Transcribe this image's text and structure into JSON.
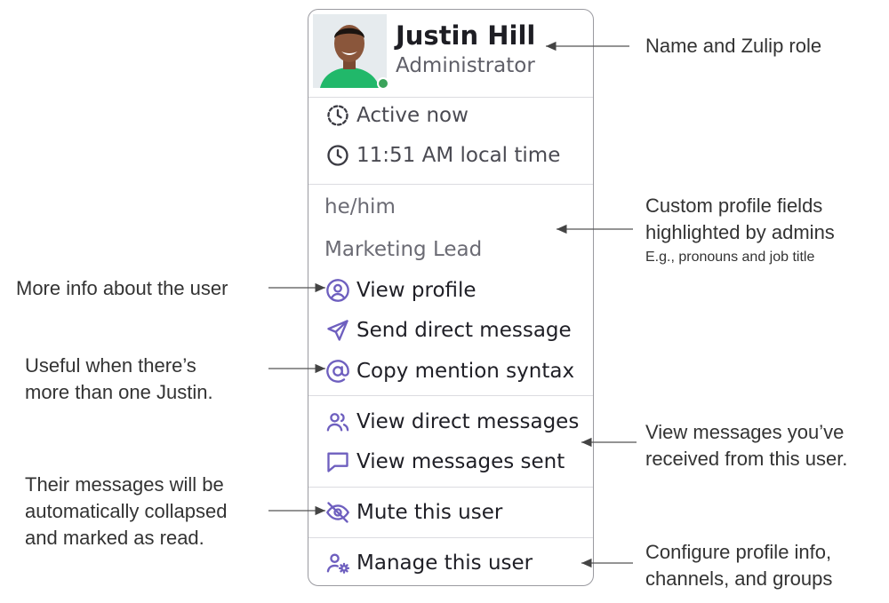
{
  "popover": {
    "user": {
      "name": "Justin Hill",
      "role": "Administrator",
      "avatar_label": "profile photo",
      "presence": "online"
    },
    "status": {
      "active": "Active now",
      "local_time": "11:51 AM local time"
    },
    "custom_fields": [
      "he/him",
      "Marketing Lead"
    ],
    "actions": {
      "view_profile": "View profile",
      "send_dm": "Send direct message",
      "copy_mention": "Copy mention syntax",
      "view_dms": "View direct messages",
      "view_sent": "View messages sent",
      "mute": "Mute this user",
      "manage": "Manage this user"
    },
    "icons": [
      "clock-dashed-icon",
      "clock-icon",
      "user-circle-icon",
      "send-icon",
      "at-icon",
      "users-icon",
      "message-square-icon",
      "eye-off-icon",
      "user-cog-icon"
    ]
  },
  "annotations": {
    "name_role": "Name and Zulip role",
    "custom_fields_line1": "Custom profile fields",
    "custom_fields_line2": "highlighted by admins",
    "custom_fields_example": "E.g., pronouns and job title",
    "more_info": "More info about the user",
    "useful_line1": "Useful when there’s",
    "useful_line2": "more than one Justin.",
    "view_received_line1": "View messages you’ve",
    "view_received_line2": "received from this user.",
    "collapsed_line1": "Their messages will be",
    "collapsed_line2": "automatically collapsed",
    "collapsed_line3": "and marked as read.",
    "configure_line1": "Configure profile info,",
    "configure_line2": "channels, and groups"
  },
  "colors": {
    "icon": "#6e5fbf",
    "text": "#1f1f26",
    "muted": "#6b6b74",
    "presence": "#3ba35b"
  }
}
